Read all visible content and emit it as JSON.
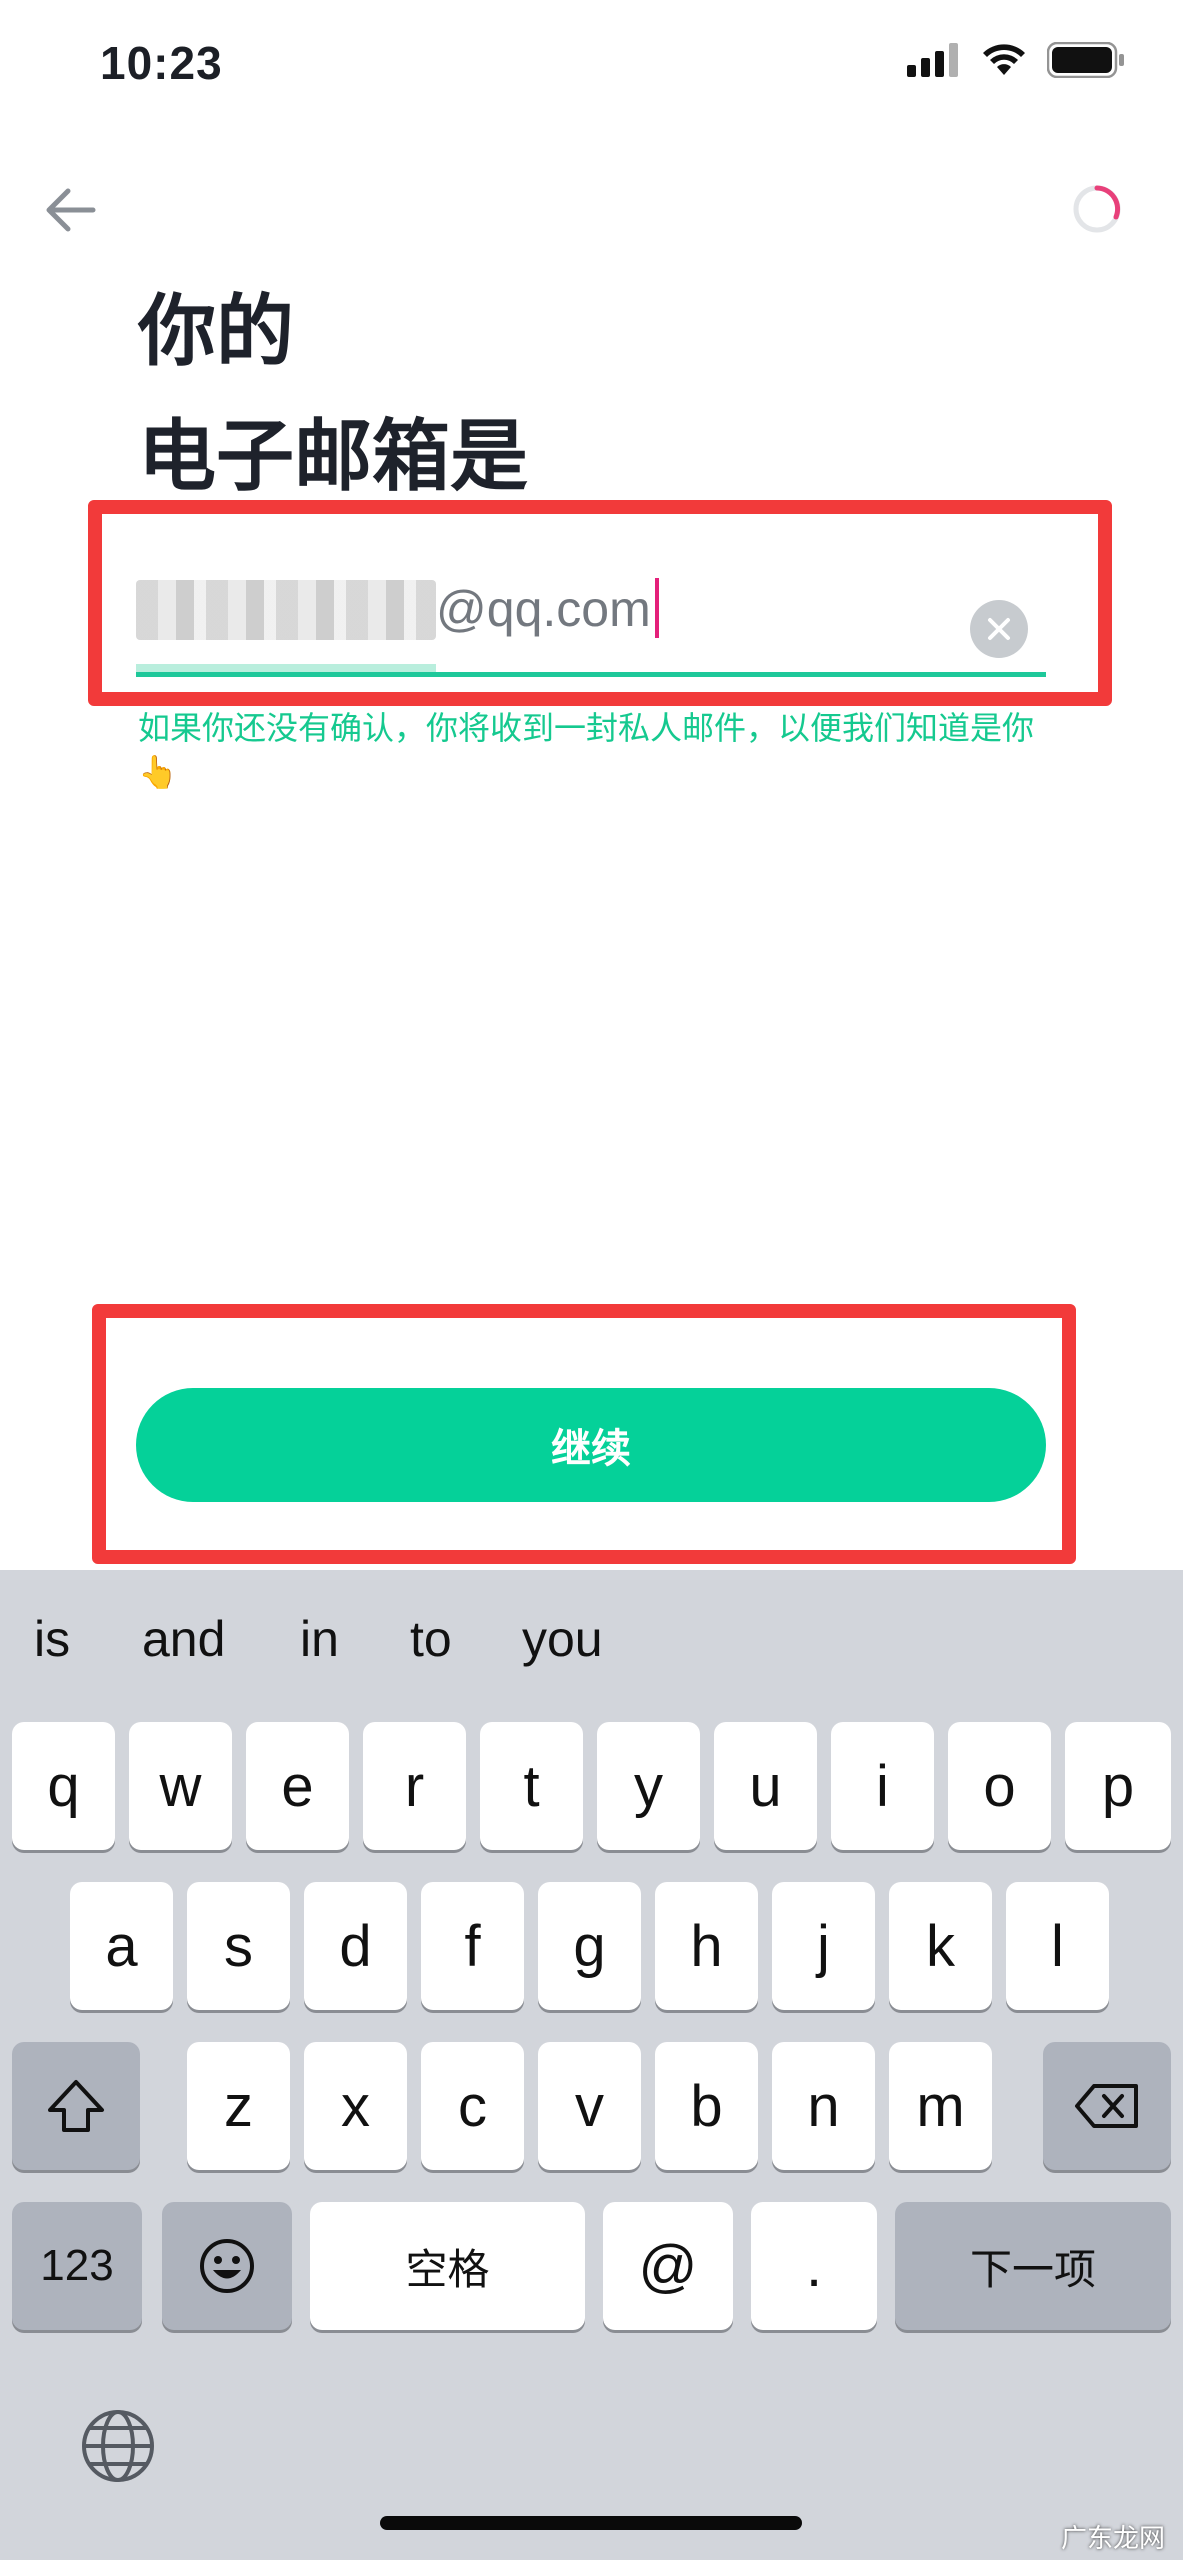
{
  "status_bar": {
    "time": "10:23"
  },
  "header": {
    "title_line1": "你的",
    "title_line2": "电子邮箱是"
  },
  "email_field": {
    "value": "@qq.com"
  },
  "hint": "如果你还没有确认，你将收到一封私人邮件，以便我们知道是你👆",
  "continue_button": {
    "label": "继续"
  },
  "keyboard": {
    "suggestions": [
      "is",
      "and",
      "in",
      "to",
      "you"
    ],
    "row1": [
      "q",
      "w",
      "e",
      "r",
      "t",
      "y",
      "u",
      "i",
      "o",
      "p"
    ],
    "row2": [
      "a",
      "s",
      "d",
      "f",
      "g",
      "h",
      "j",
      "k",
      "l"
    ],
    "row3": [
      "z",
      "x",
      "c",
      "v",
      "b",
      "n",
      "m"
    ],
    "numbers_key": "123",
    "space_key": "空格",
    "at_key": "@",
    "dot_key": ".",
    "next_key": "下一项"
  },
  "watermark": "广东龙网",
  "colors": {
    "accent": "#05d199",
    "hint": "#15c98f",
    "annotation": "#f23a3a",
    "caret": "#e4207a"
  }
}
